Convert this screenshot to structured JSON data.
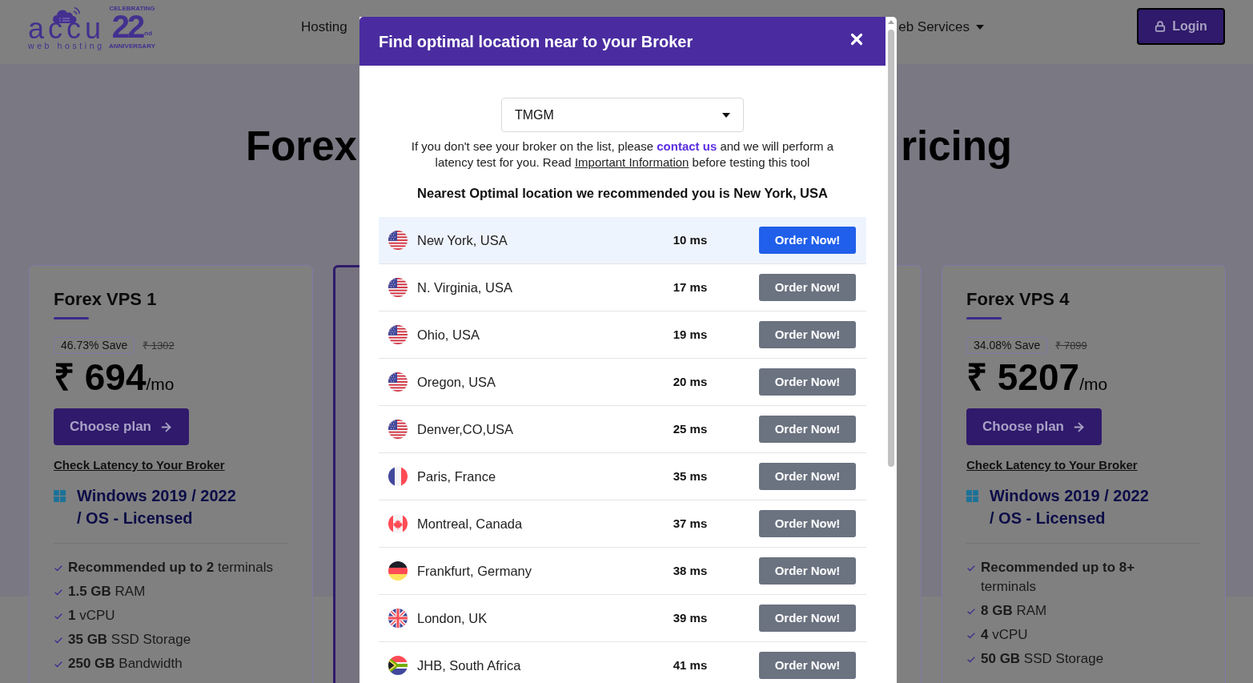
{
  "header": {
    "logo": {
      "wordmark": "accu",
      "tagline": "web hosting",
      "badge_top": "CELEBRATING",
      "badge_number": "22",
      "badge_suffix": "nd",
      "badge_bottom": "ANNIVERSARY"
    },
    "nav": [
      {
        "label": "Hosting",
        "dropdown": false
      },
      {
        "label": "eb Services",
        "dropdown": true
      }
    ],
    "login": {
      "label": "Login",
      "focused": true
    }
  },
  "hero": {
    "title_left": "Forex",
    "title_right": "ricing"
  },
  "plans": [
    {
      "highlighted": false,
      "name": "Forex VPS 1",
      "save": "46.73% Save",
      "old_price": "₹ 1302",
      "price": "₹ 694",
      "period": "/mo",
      "cta": "Choose plan",
      "latency_link": "Check Latency to Your Broker",
      "os": "Windows 2019 / 2022 / OS - Licensed",
      "features": [
        "**Recommended up to 2** terminals",
        "**1.5 GB** RAM",
        "**1** vCPU",
        "**35 GB** SSD Storage",
        "**250 GB** Bandwidth"
      ]
    },
    {
      "highlighted": true
    },
    {
      "highlighted": false
    },
    {
      "highlighted": false,
      "name": "Forex VPS 4",
      "save": "34.08% Save",
      "old_price": "₹ 7899",
      "price": "₹ 5207",
      "period": "/mo",
      "cta": "Choose plan",
      "latency_link": "Check Latency to Your Broker",
      "os": "Windows 2019 / 2022 / OS - Licensed",
      "features": [
        "**Recommended up to 8+** terminals",
        "**8 GB** RAM",
        "**4** vCPU",
        "**50 GB** SSD Storage"
      ]
    }
  ],
  "modal": {
    "title": "Find optimal location near to your Broker",
    "broker_select": {
      "value": "TMGM"
    },
    "note": {
      "text_1": "If you don't see your broker on the list, please ",
      "contact_link": "contact us",
      "text_2": " and we will perform a latency test for you. Read ",
      "info_link": "Important Information",
      "text_3": " before testing this tool"
    },
    "recommendation": "Nearest Optimal location we recommended you is New York, USA",
    "locations": [
      {
        "kind": "usa",
        "name": "New York, USA",
        "latency": "10 ms",
        "action": "Order Now!",
        "selected": true
      },
      {
        "kind": "usa",
        "name": "N. Virginia, USA",
        "latency": "17 ms",
        "action": "Order Now!",
        "selected": false
      },
      {
        "kind": "usa",
        "name": "Ohio, USA",
        "latency": "19 ms",
        "action": "Order Now!",
        "selected": false
      },
      {
        "kind": "usa",
        "name": "Oregon, USA",
        "latency": "20 ms",
        "action": "Order Now!",
        "selected": false
      },
      {
        "kind": "usa",
        "name": "Denver,CO,USA",
        "latency": "25 ms",
        "action": "Order Now!",
        "selected": false
      },
      {
        "kind": "france",
        "name": "Paris, France",
        "latency": "35 ms",
        "action": "Order Now!",
        "selected": false
      },
      {
        "kind": "canada",
        "name": "Montreal, Canada",
        "latency": "37 ms",
        "action": "Order Now!",
        "selected": false
      },
      {
        "kind": "germany",
        "name": "Frankfurt, Germany",
        "latency": "38 ms",
        "action": "Order Now!",
        "selected": false
      },
      {
        "kind": "uk",
        "name": "London, UK",
        "latency": "39 ms",
        "action": "Order Now!",
        "selected": false
      },
      {
        "kind": "southafrica",
        "name": "JHB, South Africa",
        "latency": "41 ms",
        "action": "Order Now!",
        "selected": false
      }
    ]
  }
}
